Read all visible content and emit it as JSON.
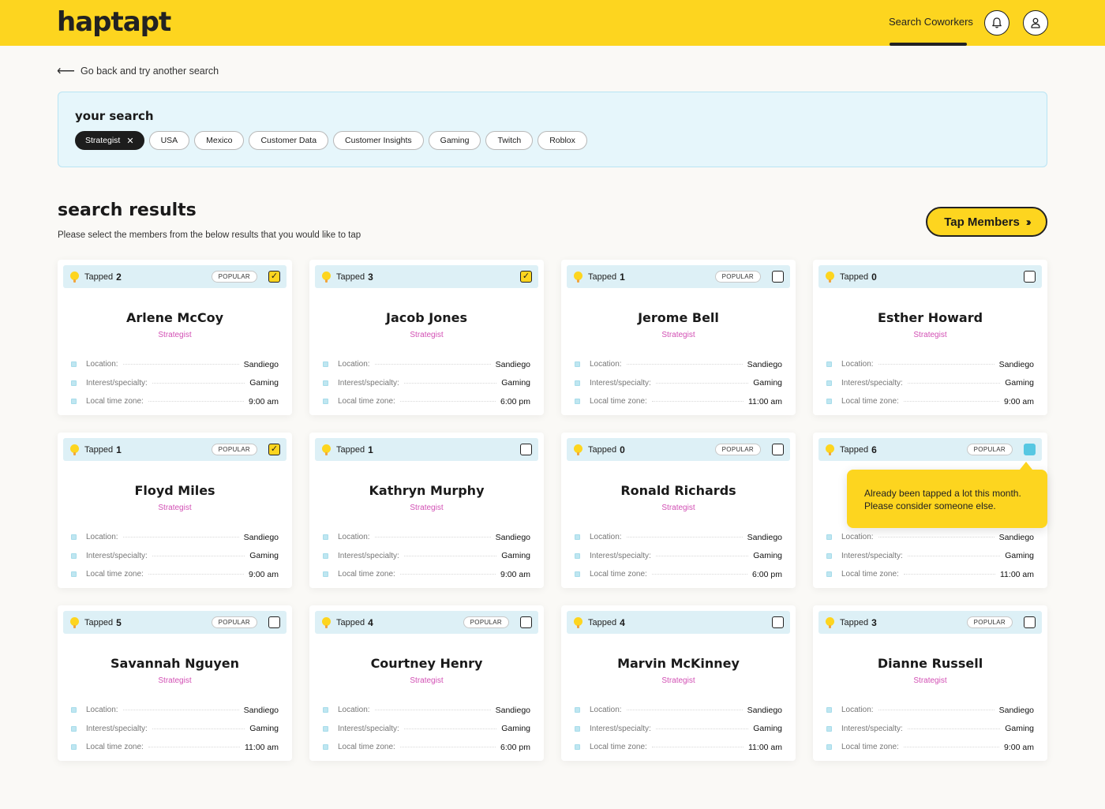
{
  "header": {
    "logo": "haptapt",
    "nav_link": "Search Coworkers"
  },
  "back_link": "Go back and try another search",
  "search": {
    "title": "your search",
    "chips": [
      "Strategist",
      "USA",
      "Mexico",
      "Customer Data",
      "Customer Insights",
      "Gaming",
      "Twitch",
      "Roblox"
    ]
  },
  "results": {
    "title": "search results",
    "subtitle": "Please select the members from the below results that you would like to tap",
    "tap_button": "Tap Members"
  },
  "card_labels": {
    "tapped": "Tapped",
    "popular": "POPULAR",
    "location": "Location:",
    "interest": "Interest/specialty:",
    "timezone": "Local time zone:"
  },
  "tooltip": "Already been tapped a lot this month. Please consider someone else.",
  "members": [
    {
      "name": "Arlene McCoy",
      "role": "Strategist",
      "tapped": "2",
      "location": "Sandiego",
      "interest": "Gaming",
      "timezone": "9:00 am"
    },
    {
      "name": "Jacob Jones",
      "role": "Strategist",
      "tapped": "3",
      "location": "Sandiego",
      "interest": "Gaming",
      "timezone": "6:00 pm"
    },
    {
      "name": "Jerome Bell",
      "role": "Strategist",
      "tapped": "1",
      "location": "Sandiego",
      "interest": "Gaming",
      "timezone": "11:00 am"
    },
    {
      "name": "Esther Howard",
      "role": "Strategist",
      "tapped": "0",
      "location": "Sandiego",
      "interest": "Gaming",
      "timezone": "9:00 am"
    },
    {
      "name": "Floyd Miles",
      "role": "Strategist",
      "tapped": "1",
      "location": "Sandiego",
      "interest": "Gaming",
      "timezone": "9:00 am"
    },
    {
      "name": "Kathryn Murphy",
      "role": "Strategist",
      "tapped": "1",
      "location": "Sandiego",
      "interest": "Gaming",
      "timezone": "9:00 am"
    },
    {
      "name": "Ronald Richards",
      "role": "Strategist",
      "tapped": "0",
      "location": "Sandiego",
      "interest": "Gaming",
      "timezone": "6:00 pm"
    },
    {
      "name": "",
      "role": "",
      "tapped": "6",
      "location": "Sandiego",
      "interest": "Gaming",
      "timezone": "11:00 am"
    },
    {
      "name": "Savannah Nguyen",
      "role": "Strategist",
      "tapped": "5",
      "location": "Sandiego",
      "interest": "Gaming",
      "timezone": "11:00 am"
    },
    {
      "name": "Courtney Henry",
      "role": "Strategist",
      "tapped": "4",
      "location": "Sandiego",
      "interest": "Gaming",
      "timezone": "6:00 pm"
    },
    {
      "name": "Marvin McKinney",
      "role": "Strategist",
      "tapped": "4",
      "location": "Sandiego",
      "interest": "Gaming",
      "timezone": "11:00 am"
    },
    {
      "name": "Dianne Russell",
      "role": "Strategist",
      "tapped": "3",
      "location": "Sandiego",
      "interest": "Gaming",
      "timezone": "9:00 am"
    }
  ],
  "colors": {
    "brand_yellow": "#fdd51f",
    "search_bg": "#e6f6fb",
    "card_header_bg": "#ddf0f6",
    "role_pink": "#d24fb4",
    "alert_teal": "#57c7e2"
  }
}
